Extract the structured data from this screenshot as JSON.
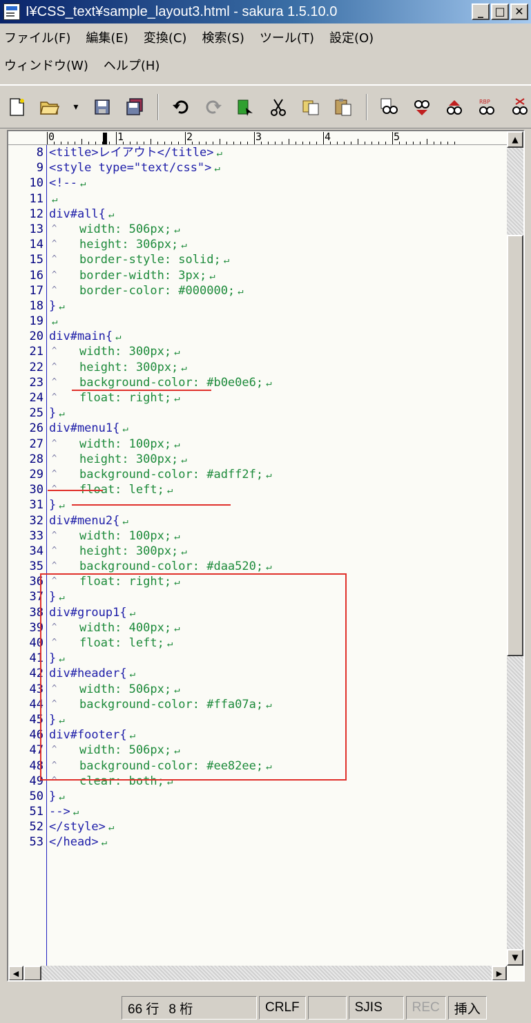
{
  "window": {
    "title": "I¥CSS_text¥sample_layout3.html - sakura 1.5.10.0",
    "minimize_glyph": "_",
    "maximize_glyph": "□",
    "close_glyph": "✕"
  },
  "menubar": {
    "row1": [
      "ファイル(F)",
      "編集(E)",
      "変換(C)",
      "検索(S)",
      "ツール(T)",
      "設定(O)"
    ],
    "row2": [
      "ウィンドウ(W)",
      "ヘルプ(H)"
    ]
  },
  "toolbar": {
    "icons": [
      "new-file-icon",
      "open-folder-icon",
      "dropdown-arrow-icon",
      "save-icon",
      "save-all-icon",
      "undo-icon",
      "redo-icon",
      "green-arrow-icon",
      "cut-icon",
      "copy-icon",
      "paste-icon",
      "compare-icon",
      "search-icon",
      "search-up-icon",
      "search-next-icon",
      "replace-icon"
    ]
  },
  "ruler": {
    "labels": [
      "0",
      "1",
      "2",
      "3",
      "4",
      "5"
    ]
  },
  "editor": {
    "lines": [
      {
        "n": "8",
        "text": "<title>レイアウト</title>",
        "indent": false
      },
      {
        "n": "9",
        "text": "<style type=\"text/css\">",
        "indent": false
      },
      {
        "n": "10",
        "text": "<!--",
        "indent": false
      },
      {
        "n": "11",
        "text": "",
        "indent": false
      },
      {
        "n": "12",
        "text": "div#all{",
        "indent": false
      },
      {
        "n": "13",
        "text": "width: 506px;",
        "indent": true
      },
      {
        "n": "14",
        "text": "height: 306px;",
        "indent": true
      },
      {
        "n": "15",
        "text": "border-style: solid;",
        "indent": true
      },
      {
        "n": "16",
        "text": "border-width: 3px;",
        "indent": true
      },
      {
        "n": "17",
        "text": "border-color: #000000;",
        "indent": true
      },
      {
        "n": "18",
        "text": "}",
        "indent": false
      },
      {
        "n": "19",
        "text": "",
        "indent": false
      },
      {
        "n": "20",
        "text": "div#main{",
        "indent": false
      },
      {
        "n": "21",
        "text": "width: 300px;",
        "indent": true
      },
      {
        "n": "22",
        "text": "height: 300px;",
        "indent": true
      },
      {
        "n": "23",
        "text": "background-color: #b0e0e6;",
        "indent": true
      },
      {
        "n": "24",
        "text": "float: right;",
        "indent": true
      },
      {
        "n": "25",
        "text": "}",
        "indent": false
      },
      {
        "n": "26",
        "text": "div#menu1{",
        "indent": false
      },
      {
        "n": "27",
        "text": "width: 100px;",
        "indent": true
      },
      {
        "n": "28",
        "text": "height: 300px;",
        "indent": true
      },
      {
        "n": "29",
        "text": "background-color: #adff2f;",
        "indent": true
      },
      {
        "n": "30",
        "text": "float: left;",
        "indent": true
      },
      {
        "n": "31",
        "text": "}",
        "indent": false
      },
      {
        "n": "32",
        "text": "div#menu2{",
        "indent": false
      },
      {
        "n": "33",
        "text": "width: 100px;",
        "indent": true
      },
      {
        "n": "34",
        "text": "height: 300px;",
        "indent": true
      },
      {
        "n": "35",
        "text": "background-color: #daa520;",
        "indent": true
      },
      {
        "n": "36",
        "text": "float: right;",
        "indent": true
      },
      {
        "n": "37",
        "text": "}",
        "indent": false
      },
      {
        "n": "38",
        "text": "div#group1{",
        "indent": false
      },
      {
        "n": "39",
        "text": "width: 400px;",
        "indent": true
      },
      {
        "n": "40",
        "text": "float: left;",
        "indent": true
      },
      {
        "n": "41",
        "text": "}",
        "indent": false
      },
      {
        "n": "42",
        "text": "div#header{",
        "indent": false
      },
      {
        "n": "43",
        "text": "width: 506px;",
        "indent": true
      },
      {
        "n": "44",
        "text": "background-color: #ffa07a;",
        "indent": true
      },
      {
        "n": "45",
        "text": "}",
        "indent": false
      },
      {
        "n": "46",
        "text": "div#footer{",
        "indent": false
      },
      {
        "n": "47",
        "text": "width: 506px;",
        "indent": true
      },
      {
        "n": "48",
        "text": "background-color: #ee82ee;",
        "indent": true
      },
      {
        "n": "49",
        "text": "clear: both;",
        "indent": true
      },
      {
        "n": "50",
        "text": "}",
        "indent": false
      },
      {
        "n": "51",
        "text": "-->",
        "indent": false
      },
      {
        "n": "52",
        "text": "</style>",
        "indent": false
      },
      {
        "n": "53",
        "text": "</head>",
        "indent": false
      }
    ],
    "eol_mark": "↵"
  },
  "statusbar": {
    "line": "66 行",
    "column": "8 桁",
    "newline": "CRLF",
    "blank": "",
    "encoding": "SJIS",
    "rec": "REC",
    "mode": "挿入"
  },
  "colors": {
    "annotation": "#e0302a",
    "code_text": "#1c1ca8",
    "line_number": "#000080"
  }
}
